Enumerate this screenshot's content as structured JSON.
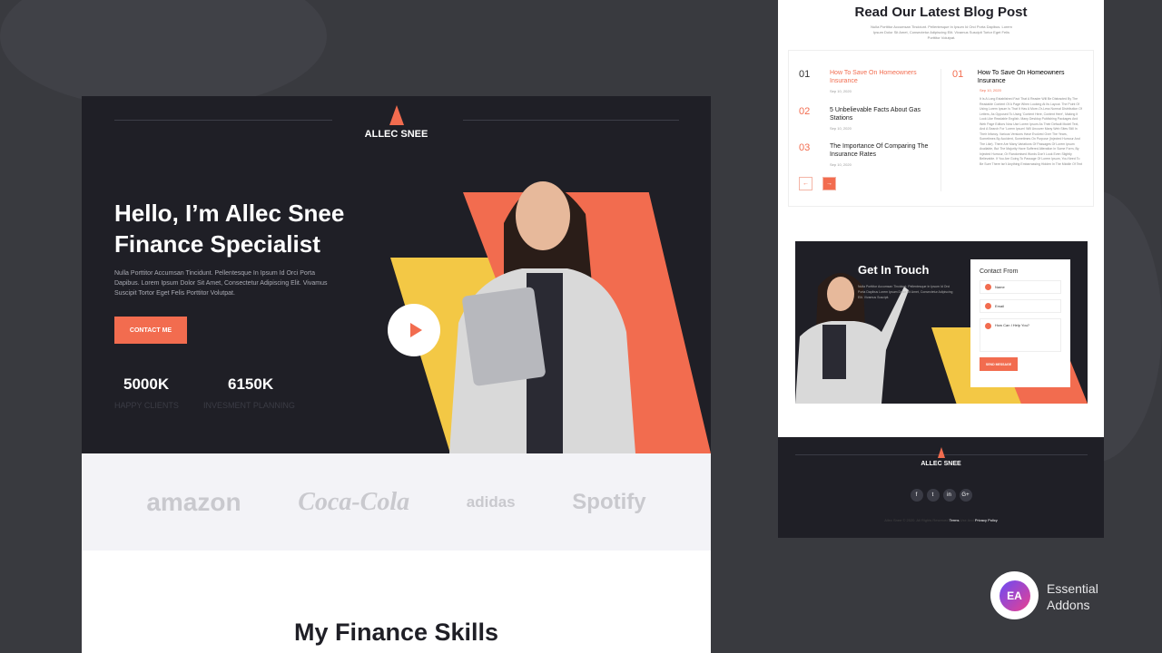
{
  "hero": {
    "brand": "ALLEC SNEE",
    "headline_1": "Hello, I’m Allec Snee",
    "headline_2": "Finance Specialist",
    "description": "Nulla Porttitor Accumsan Tincidunt. Pellentesque In Ipsum Id Orci Porta Dapibus. Lorem Ipsum Dolor Sit Amet, Consectetur Adipiscing Elit. Vivamus Suscipit Tortor Eget Felis Porttitor Volutpat.",
    "cta": "CONTACT ME",
    "stats": [
      {
        "value": "5000K",
        "label": "HAPPY CLIENTS"
      },
      {
        "value": "6150K",
        "label": "INVESMENT PLANNING"
      }
    ]
  },
  "brands": [
    "amazon",
    "Coca-Cola",
    "adidas",
    "Spotify"
  ],
  "skills_title": "My Finance Skills",
  "blog": {
    "title": "Read Our Latest Blog Post",
    "subtitle": "Nulla Porttitor Accumsan Tincidunt. Pellentesque In Ipsum Id Orci Porta Dapibus. Lorem Ipsum Dolor Sit Amet, Consectetur Adipiscing Elit. Vivamus Suscipit Tortor Eget Felis Porttitor Volutpat.",
    "items": [
      {
        "num": "01",
        "title": "How To Save On Homeowners Insurance",
        "date": "Sep 10, 2020"
      },
      {
        "num": "02",
        "title": "5 Unbelievable Facts About Gas Stations",
        "date": "Sep 10, 2020"
      },
      {
        "num": "03",
        "title": "The Importance Of Comparing The Insurance Rates",
        "date": "Sep 10, 2020"
      }
    ],
    "prev": "←",
    "next": "→",
    "detail": {
      "num": "01",
      "title": "How To Save On Homeowners Insurance",
      "date": "Sep 10, 2020",
      "body": "It Is A Long Established Fact That A Reader Will Be Distracted By The Readable Content Of A Page When Looking At Its Layout. The Point Of Using Lorem Ipsum Is That It Has A More-Or-Less Normal Distribution Of Letters, As Opposed To Using 'Content Here, Content Here', Making It Look Like Readable English. Many Desktop Publishing Packages And Web Page Editors Now Use Lorem Ipsum As Their Default Model Text, And A Search For 'Lorem Ipsum' Will Uncover Many Web Sites Still In Their Infancy. Various Versions Have Evolved Over The Years, Sometimes By Accident, Sometimes On Purpose (Injected Humour And The Like). There Are Many Variations Of Passages Of Lorem Ipsum Available, But The Majority Have Suffered Alteration In Some Form, By Injected Humour, Or Randomised Words Don't Look Even Slightly Believable. If You Are Going To Passage Of Lorem Ipsum, You Need To Be Sure There Isn't Anything Embarrassing Hidden In The Middle Of Text"
    }
  },
  "contact": {
    "title": "Get In Touch",
    "text": "Nulla Porttitor Accumsan Tincidunt. Pellentesque In Ipsum Id Orci Porta Dapibus Lorem Ipsum Dolor Sit Amet, Consectetur Adipiscing Elit. Vivamus Suscipit.",
    "form_title": "Contact From",
    "name": "Name",
    "email": "Email",
    "message": "How Can I Help You?",
    "send": "SEND MESSAGE"
  },
  "footer": {
    "brand": "ALLEC SNEE",
    "social": [
      "f",
      "t",
      "in",
      "G+"
    ],
    "copyright": "Allec Snee © 2020. All Rights Reserved",
    "terms": "Terms",
    "sep": "Use And",
    "privacy": "Privacy Policy"
  },
  "badge": {
    "logo": "EA",
    "line1": "Essential",
    "line2": "Addons"
  }
}
